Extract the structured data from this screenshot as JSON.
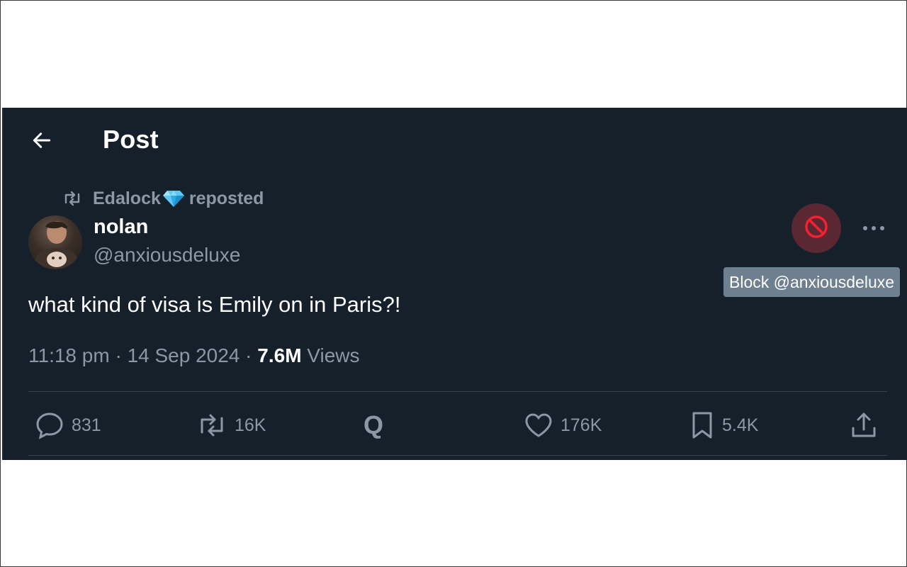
{
  "header": {
    "title": "Post"
  },
  "repost": {
    "reposter": "Edalock",
    "suffix": "reposted"
  },
  "author": {
    "name": "nolan",
    "handle": "@anxiousdeluxe"
  },
  "tooltip": {
    "text": "Block @anxiousdeluxe"
  },
  "post": {
    "text": "what kind of visa is Emily on in Paris?!",
    "time": "11:18 pm",
    "date": "14 Sep 2024",
    "views_count": "7.6M",
    "views_label": "Views",
    "separator": "·"
  },
  "actions": {
    "replies": "831",
    "reposts": "16K",
    "quote_glyph": "Q",
    "likes": "176K",
    "bookmarks": "5.4K"
  },
  "colors": {
    "background": "#15202b",
    "secondary_text": "#8b98a5",
    "block_accent": "#f4212e",
    "divider": "#38444d"
  },
  "icons": {
    "back": "arrow-left-icon",
    "repost": "repost-icon",
    "diamond": "diamond-icon",
    "block": "block-icon",
    "more": "more-horizontal-icon",
    "reply": "reply-icon",
    "quote": "quote-icon",
    "like": "heart-icon",
    "bookmark": "bookmark-icon",
    "share": "share-icon"
  }
}
